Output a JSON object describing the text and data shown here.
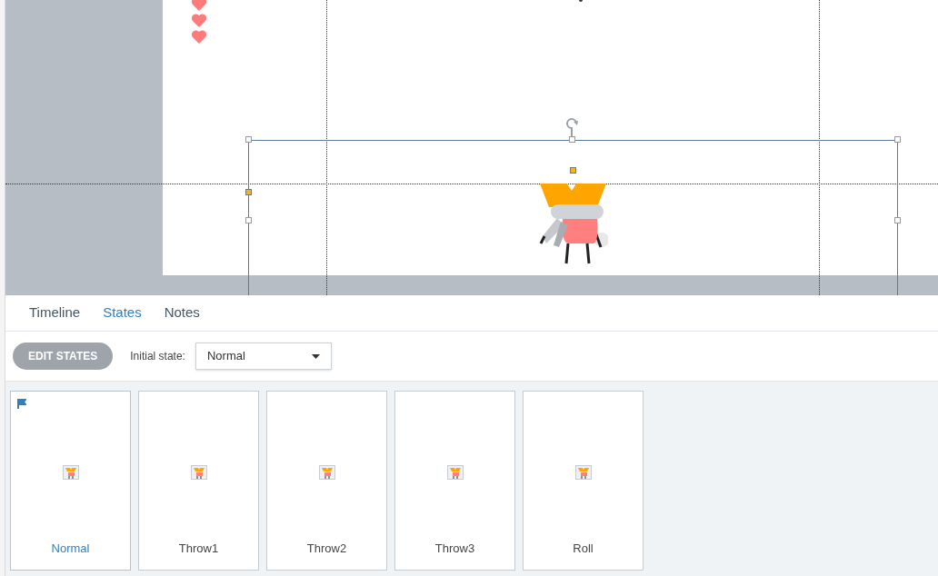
{
  "tabs": [
    {
      "label": "Timeline",
      "selected": false
    },
    {
      "label": "States",
      "selected": true
    },
    {
      "label": "Notes",
      "selected": false
    }
  ],
  "toolbar": {
    "edit_button": "EDIT STATES",
    "initial_state_label": "Initial state:",
    "initial_state_value": "Normal"
  },
  "states": [
    {
      "name": "Normal",
      "selected": true,
      "initial": true
    },
    {
      "name": "Throw1",
      "selected": false,
      "initial": false
    },
    {
      "name": "Throw2",
      "selected": false,
      "initial": false
    },
    {
      "name": "Throw3",
      "selected": false,
      "initial": false
    },
    {
      "name": "Roll",
      "selected": false,
      "initial": false
    }
  ]
}
